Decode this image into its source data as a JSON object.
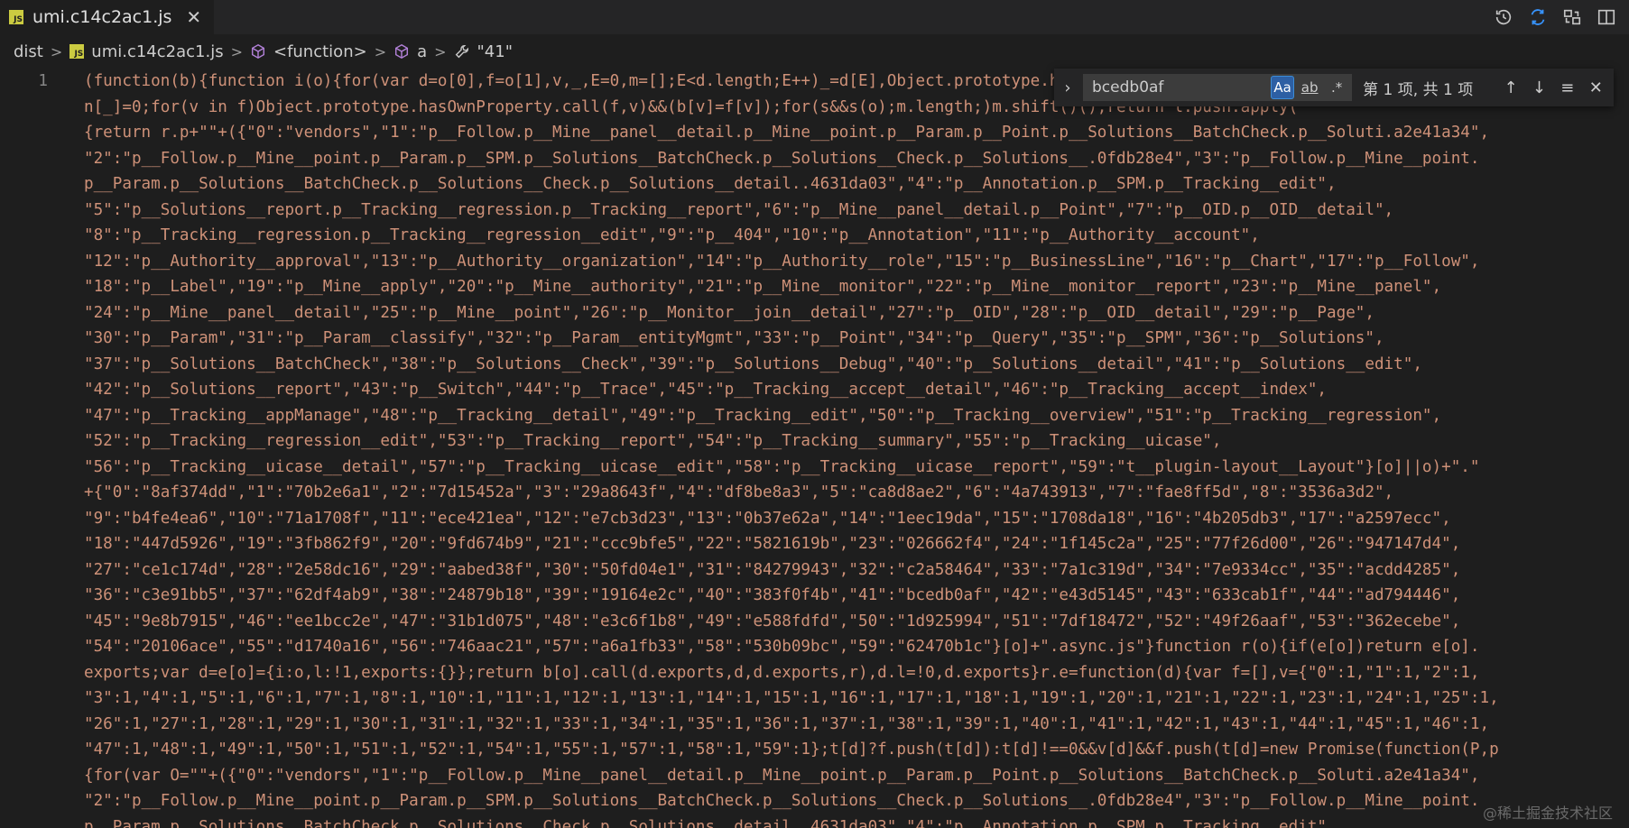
{
  "tab": {
    "badge": "JS",
    "title": "umi.c14c2ac1.js",
    "close_glyph": "✕"
  },
  "tab_actions": [
    "history-icon",
    "sync-diff-icon",
    "git-compare-icon",
    "split-editor-icon",
    "more-actions-icon"
  ],
  "breadcrumb": {
    "items": [
      "dist",
      "umi.c14c2ac1.js",
      "<function>",
      "a",
      "\"41\""
    ],
    "separator": ">"
  },
  "editor": {
    "line_number": "1",
    "lines": [
      "(function(b){function i(o){for(var d=o[0],f=o[1],v,_,E=0,m=[];E<d.length;E++)_=d[E],Object.prototype.hasOwnProperty.call(",
      "n[_]=0;for(v in f)Object.prototype.hasOwnProperty.call(f,v)&&(b[v]=f[v]);for(s&&s(o);m.length;)m.shift()();return l.push.apply(",
      "{return r.p+\"\"+({\"0\":\"vendors\",\"1\":\"p__Follow.p__Mine__panel__detail.p__Mine__point.p__Param.p__Point.p__Solutions__BatchCheck.p__Soluti.a2e41a34\",",
      "\"2\":\"p__Follow.p__Mine__point.p__Param.p__SPM.p__Solutions__BatchCheck.p__Solutions__Check.p__Solutions__.0fdb28e4\",\"3\":\"p__Follow.p__Mine__point.",
      "p__Param.p__Solutions__BatchCheck.p__Solutions__Check.p__Solutions__detail..4631da03\",\"4\":\"p__Annotation.p__SPM.p__Tracking__edit\",",
      "\"5\":\"p__Solutions__report.p__Tracking__regression.p__Tracking__report\",\"6\":\"p__Mine__panel__detail.p__Point\",\"7\":\"p__OID.p__OID__detail\",",
      "\"8\":\"p__Tracking__regression.p__Tracking__regression__edit\",\"9\":\"p__404\",\"10\":\"p__Annotation\",\"11\":\"p__Authority__account\",",
      "\"12\":\"p__Authority__approval\",\"13\":\"p__Authority__organization\",\"14\":\"p__Authority__role\",\"15\":\"p__BusinessLine\",\"16\":\"p__Chart\",\"17\":\"p__Follow\",",
      "\"18\":\"p__Label\",\"19\":\"p__Mine__apply\",\"20\":\"p__Mine__authority\",\"21\":\"p__Mine__monitor\",\"22\":\"p__Mine__monitor__report\",\"23\":\"p__Mine__panel\",",
      "\"24\":\"p__Mine__panel__detail\",\"25\":\"p__Mine__point\",\"26\":\"p__Monitor__join__detail\",\"27\":\"p__OID\",\"28\":\"p__OID__detail\",\"29\":\"p__Page\",",
      "\"30\":\"p__Param\",\"31\":\"p__Param__classify\",\"32\":\"p__Param__entityMgmt\",\"33\":\"p__Point\",\"34\":\"p__Query\",\"35\":\"p__SPM\",\"36\":\"p__Solutions\",",
      "\"37\":\"p__Solutions__BatchCheck\",\"38\":\"p__Solutions__Check\",\"39\":\"p__Solutions__Debug\",\"40\":\"p__Solutions__detail\",\"41\":\"p__Solutions__edit\",",
      "\"42\":\"p__Solutions__report\",\"43\":\"p__Switch\",\"44\":\"p__Trace\",\"45\":\"p__Tracking__accept__detail\",\"46\":\"p__Tracking__accept__index\",",
      "\"47\":\"p__Tracking__appManage\",\"48\":\"p__Tracking__detail\",\"49\":\"p__Tracking__edit\",\"50\":\"p__Tracking__overview\",\"51\":\"p__Tracking__regression\",",
      "\"52\":\"p__Tracking__regression__edit\",\"53\":\"p__Tracking__report\",\"54\":\"p__Tracking__summary\",\"55\":\"p__Tracking__uicase\",",
      "\"56\":\"p__Tracking__uicase__detail\",\"57\":\"p__Tracking__uicase__edit\",\"58\":\"p__Tracking__uicase__report\",\"59\":\"t__plugin-layout__Layout\"}[o]||o)+\".\"",
      "+{\"0\":\"8af374dd\",\"1\":\"70b2e6a1\",\"2\":\"7d15452a\",\"3\":\"29a8643f\",\"4\":\"df8be8a3\",\"5\":\"ca8d8ae2\",\"6\":\"4a743913\",\"7\":\"fae8ff5d\",\"8\":\"3536a3d2\",",
      "\"9\":\"b4fe4ea6\",\"10\":\"71a1708f\",\"11\":\"ece421ea\",\"12\":\"e7cb3d23\",\"13\":\"0b37e62a\",\"14\":\"1eec19da\",\"15\":\"1708da18\",\"16\":\"4b205db3\",\"17\":\"a2597ecc\",",
      "\"18\":\"447d5926\",\"19\":\"3fb862f9\",\"20\":\"9fd674b9\",\"21\":\"ccc9bfe5\",\"22\":\"5821619b\",\"23\":\"026662f4\",\"24\":\"1f145c2a\",\"25\":\"77f26d00\",\"26\":\"947147d4\",",
      "\"27\":\"ce1c174d\",\"28\":\"2e58dc16\",\"29\":\"aabed38f\",\"30\":\"50fd04e1\",\"31\":\"84279943\",\"32\":\"c2a58464\",\"33\":\"7a1c319d\",\"34\":\"7e9334cc\",\"35\":\"acdd4285\",",
      "\"36\":\"c3e91bb5\",\"37\":\"62df4ab9\",\"38\":\"24879b18\",\"39\":\"19164e2c\",\"40\":\"383f0f4b\",\"41\":\"bcedb0af\",\"42\":\"e43d5145\",\"43\":\"633cab1f\",\"44\":\"ad794446\",",
      "\"45\":\"9e8b7915\",\"46\":\"ee1bcc2e\",\"47\":\"31b1d075\",\"48\":\"e3c6f1b8\",\"49\":\"e588fdfd\",\"50\":\"1d925994\",\"51\":\"7df18472\",\"52\":\"49f26aaf\",\"53\":\"362ecebe\",",
      "\"54\":\"20106ace\",\"55\":\"d1740a16\",\"56\":\"746aac21\",\"57\":\"a6a1fb33\",\"58\":\"530b09bc\",\"59\":\"62470b1c\"}[o]+\".async.js\"}function r(o){if(e[o])return e[o].",
      "exports;var d=e[o]={i:o,l:!1,exports:{}};return b[o].call(d.exports,d,d.exports,r),d.l=!0,d.exports}r.e=function(d){var f=[],v={\"0\":1,\"1\":1,\"2\":1,",
      "\"3\":1,\"4\":1,\"5\":1,\"6\":1,\"7\":1,\"8\":1,\"10\":1,\"11\":1,\"12\":1,\"13\":1,\"14\":1,\"15\":1,\"16\":1,\"17\":1,\"18\":1,\"19\":1,\"20\":1,\"21\":1,\"22\":1,\"23\":1,\"24\":1,\"25\":1,",
      "\"26\":1,\"27\":1,\"28\":1,\"29\":1,\"30\":1,\"31\":1,\"32\":1,\"33\":1,\"34\":1,\"35\":1,\"36\":1,\"37\":1,\"38\":1,\"39\":1,\"40\":1,\"41\":1,\"42\":1,\"43\":1,\"44\":1,\"45\":1,\"46\":1,",
      "\"47\":1,\"48\":1,\"49\":1,\"50\":1,\"51\":1,\"52\":1,\"54\":1,\"55\":1,\"57\":1,\"58\":1,\"59\":1};t[d]?f.push(t[d]):t[d]!==0&&v[d]&&f.push(t[d]=new Promise(function(P,p",
      "{for(var O=\"\"+({\"0\":\"vendors\",\"1\":\"p__Follow.p__Mine__panel__detail.p__Mine__point.p__Param.p__Point.p__Solutions__BatchCheck.p__Soluti.a2e41a34\",",
      "\"2\":\"p__Follow.p__Mine__point.p__Param.p__SPM.p__Solutions__BatchCheck.p__Solutions__Check.p__Solutions__.0fdb28e4\",\"3\":\"p__Follow.p__Mine__point.",
      "p__Param.p__Solutions__BatchCheck.p__Solutions__Check.p__Solutions__detail..4631da03\",\"4\":\"p__Annotation.p__SPM.p__Tracking__edit\","
    ],
    "match_line_index": 21,
    "match_text": "bcedb0af"
  },
  "find_widget": {
    "query": "bcedb0af",
    "match_case_label": "Aa",
    "whole_word_label": "ab",
    "regex_label": ".*",
    "result_count": "第 1 项, 共 1 项"
  },
  "watermark": "@稀土掘金技术社区",
  "colors": {
    "background": "#1e1e1e",
    "string": "#ce9178",
    "match_border": "#e51400",
    "active_option": "#2d5fa3",
    "js_badge": "#cbcb41"
  }
}
